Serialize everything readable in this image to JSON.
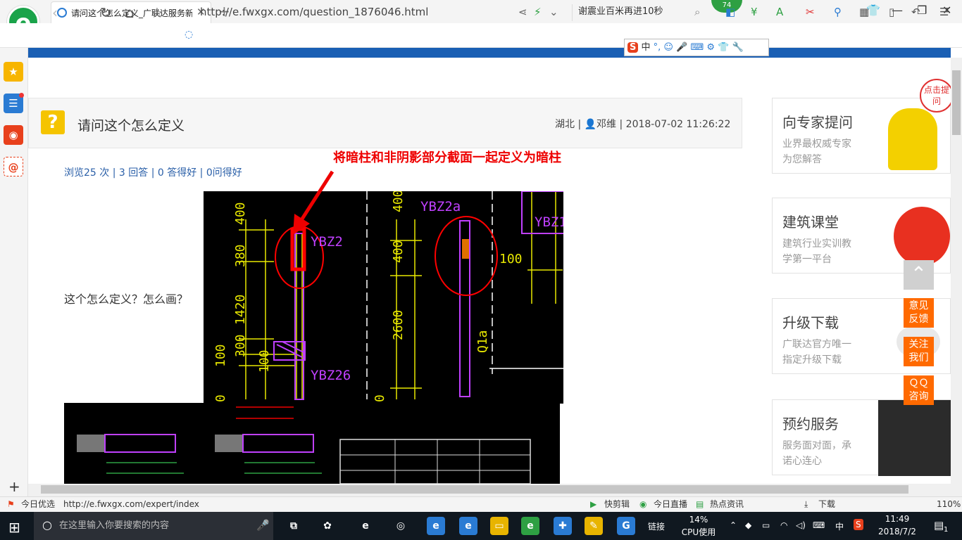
{
  "browser": {
    "tab_title": "请问这个怎么定义_广联达服务新",
    "url": "http://e.fwxgx.com/question_1876046.html",
    "search_text": "谢震业百米再进10秒",
    "badge_count": "74",
    "ime": {
      "brand": "S",
      "mode": "中"
    }
  },
  "question": {
    "title": "请问这个怎么定义",
    "meta": "湖北 | 👤邓维 | 2018-07-02 11:26:22",
    "stats": "浏览25 次 | 3 回答 | 0 答得好 | 0问得好",
    "body": "这个怎么定义？怎么画？",
    "annotation": "将暗柱和非阴影部分截面一起定义为暗柱"
  },
  "cad_labels": {
    "dims_left": [
      "400",
      "380",
      "1420",
      "300",
      "100",
      "0"
    ],
    "col_ybz2": "YBZ2",
    "col_ybz2a": "YBZ2a",
    "col_ybz1": "YBZ1",
    "col_ybz26": "YBZ26",
    "dims_mid": [
      "400",
      "400",
      "2600",
      "0"
    ],
    "dim_100": "100",
    "dim_100b": "100",
    "label_q1a": "Q1a"
  },
  "sidebar": {
    "cards": [
      {
        "title": "向专家提问",
        "line1": "业界最权威专家",
        "line2": "为您解答"
      },
      {
        "title": "建筑课堂",
        "line1": "建筑行业实训教",
        "line2": "学第一平台"
      },
      {
        "title": "升级下载",
        "line1": "广联达官方唯一",
        "line2": "指定升级下载"
      },
      {
        "title": "预约服务",
        "line1": "服务面对面，承",
        "line2": "诺心连心"
      }
    ],
    "float_buttons": [
      {
        "line1": "意见",
        "line2": "反馈"
      },
      {
        "line1": "关注",
        "line2": "我们"
      },
      {
        "line1": "ＱＱ",
        "line2": "咨询"
      }
    ],
    "bubble_text": "点击提问"
  },
  "statusbar": {
    "left_label": "今日优选",
    "hover_url": "http://e.fwxgx.com/expert/index",
    "items": [
      "快剪辑",
      "今日直播",
      "热点资讯",
      "下载"
    ],
    "zoom": "110%"
  },
  "taskbar": {
    "search_placeholder": "在这里输入你要搜索的内容",
    "link_label": "链接",
    "cpu_percent": "14%",
    "cpu_label": "CPU使用",
    "ime_char": "中",
    "time": "11:49",
    "date": "2018/7/2",
    "notif_count": "1"
  },
  "colors": {
    "brand_blue": "#1a5fb4",
    "accent_orange": "#ff6a00",
    "annotation_red": "#e00000",
    "cad_yellow": "#e8e800",
    "cad_magenta": "#c040ff"
  }
}
